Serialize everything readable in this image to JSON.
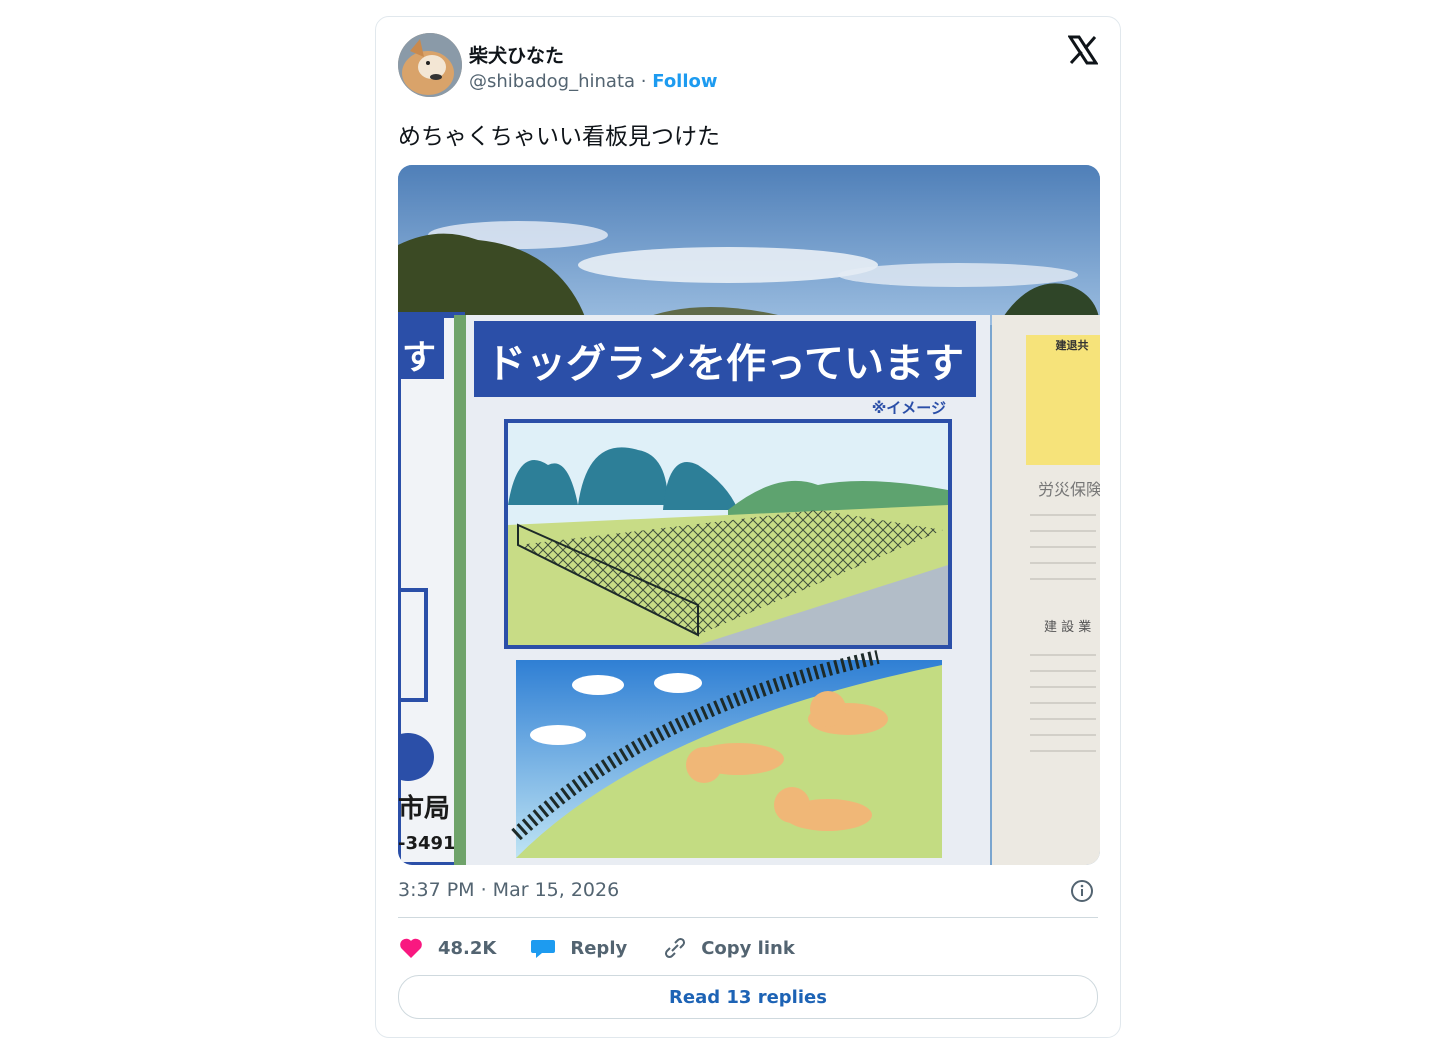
{
  "tweet": {
    "author_name": "柴犬ひなた",
    "author_handle": "@shibadog_hinata",
    "separator": "·",
    "follow_label": "Follow",
    "text": "めちゃくちゃいい看板見つけた",
    "timestamp": "3:37 PM · Mar 15, 2026",
    "likes_count": "48.2K",
    "reply_label": "Reply",
    "copy_link_label": "Copy link",
    "read_replies_label": "Read 13 replies"
  },
  "sign": {
    "headline": "ドッグランを作っています",
    "image_note": "※イメージ",
    "left_sign_char": "す",
    "left_sign_office": "市局",
    "left_sign_phone": "-3491",
    "notice_title": "建退共",
    "notice_sub": "労災保険",
    "notice_sub2": "建 設 業"
  },
  "icons": {
    "close": "x-logo-icon",
    "info": "info-icon",
    "like": "heart-icon",
    "reply": "speech-bubble-icon",
    "copy": "link-icon"
  },
  "colors": {
    "accent": "#1d9bf0",
    "like": "#f91880",
    "sign_blue": "#2b4fa8"
  }
}
